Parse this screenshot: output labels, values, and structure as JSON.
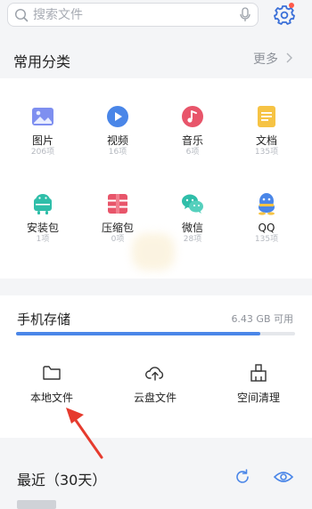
{
  "search": {
    "placeholder": "搜索文件"
  },
  "categories_section": {
    "title": "常用分类",
    "more": "更多",
    "items": [
      {
        "label": "图片",
        "count": "206项",
        "icon": "image-icon",
        "color": "#7e8ff0"
      },
      {
        "label": "视频",
        "count": "16项",
        "icon": "video-icon",
        "color": "#4a86e8"
      },
      {
        "label": "音乐",
        "count": "6项",
        "icon": "music-icon",
        "color": "#e8556a"
      },
      {
        "label": "文档",
        "count": "135项",
        "icon": "document-icon",
        "color": "#f6c344"
      },
      {
        "label": "安装包",
        "count": "1项",
        "icon": "android-icon",
        "color": "#2fbea9"
      },
      {
        "label": "压缩包",
        "count": "0项",
        "icon": "archive-icon",
        "color": "#e8556a"
      },
      {
        "label": "微信",
        "count": "28项",
        "icon": "wechat-icon",
        "color": "#2fbea9"
      },
      {
        "label": "QQ",
        "count": "135项",
        "icon": "qq-icon",
        "color": "#4a86e8"
      }
    ]
  },
  "storage": {
    "title": "手机存储",
    "available": "6.43 GB 可用",
    "used_fraction": 0.875
  },
  "quick_actions": [
    {
      "label": "本地文件",
      "icon": "folder-icon"
    },
    {
      "label": "云盘文件",
      "icon": "cloud-upload-icon"
    },
    {
      "label": "空间清理",
      "icon": "broom-icon"
    }
  ],
  "recent": {
    "title": "最近（30天）"
  },
  "colors": {
    "accent": "#4a86e8",
    "annotation_arrow": "#e63b2e",
    "settings_badge": "#ff5a4a"
  }
}
